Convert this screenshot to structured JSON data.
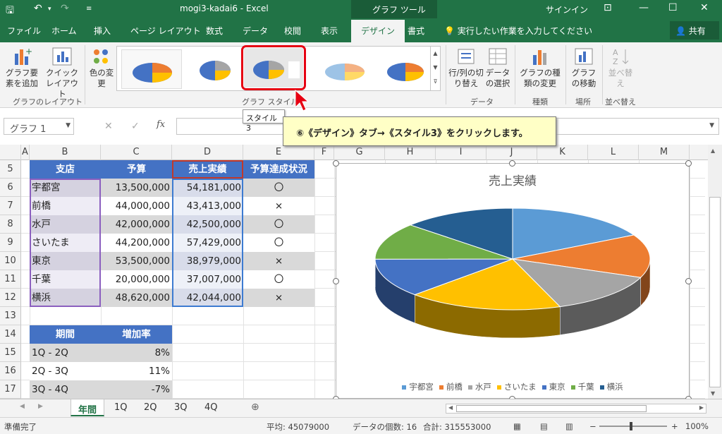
{
  "window": {
    "title": "mogi3-kadai6 - Excel",
    "tools_label": "グラフ ツール",
    "signin": "サインイン"
  },
  "tabs": [
    "ファイル",
    "ホーム",
    "挿入",
    "ページ レイアウト",
    "数式",
    "データ",
    "校閲",
    "表示",
    "デザイン",
    "書式"
  ],
  "tellme": "実行したい作業を入力してください",
  "share": "共有",
  "ribbon": {
    "add_element": "グラフ要素を追加",
    "quick_layout": "クイックレイアウト",
    "layout_group": "グラフのレイアウト",
    "colors": "色の変更",
    "style_group": "グラフ スタイル",
    "switch": "行/列の切り替え",
    "select_data": "データの選択",
    "data_group": "データ",
    "change_type": "グラフの種類の変更",
    "type_group": "種類",
    "move": "グラフの移動",
    "place_group": "場所",
    "sort": "並べ替え",
    "sort_group": "並べ替え"
  },
  "tooltip": "スタイル 3",
  "callout": "⑥《デザイン》タブ→《スタイル3》をクリックします。",
  "namebox": "グラフ 1",
  "columns": [
    "A",
    "B",
    "C",
    "D",
    "E",
    "F",
    "G",
    "H",
    "I",
    "J",
    "K",
    "L",
    "M"
  ],
  "rows": [
    "5",
    "6",
    "7",
    "8",
    "9",
    "10",
    "11",
    "12",
    "13",
    "14",
    "15",
    "16",
    "17"
  ],
  "table1": {
    "headers": [
      "支店",
      "予算",
      "売上実績",
      "予算達成状況"
    ],
    "rows": [
      [
        "宇都宮",
        "13,500,000",
        "54,181,000",
        "〇"
      ],
      [
        "前橋",
        "44,000,000",
        "43,413,000",
        "×"
      ],
      [
        "水戸",
        "42,000,000",
        "42,500,000",
        "〇"
      ],
      [
        "さいたま",
        "44,200,000",
        "57,429,000",
        "〇"
      ],
      [
        "東京",
        "53,500,000",
        "38,979,000",
        "×"
      ],
      [
        "千葉",
        "20,000,000",
        "37,007,000",
        "〇"
      ],
      [
        "横浜",
        "48,620,000",
        "42,044,000",
        "×"
      ]
    ]
  },
  "table2": {
    "headers": [
      "期間",
      "増加率"
    ],
    "rows": [
      [
        "1Q - 2Q",
        "8%"
      ],
      [
        "2Q - 3Q",
        "11%"
      ],
      [
        "3Q - 4Q",
        "-7%"
      ]
    ]
  },
  "chart_data": {
    "type": "pie",
    "title": "売上実績",
    "categories": [
      "宇都宮",
      "前橋",
      "水戸",
      "さいたま",
      "東京",
      "千葉",
      "横浜"
    ],
    "values": [
      54181000,
      43413000,
      42500000,
      57429000,
      38979000,
      37007000,
      42044000
    ],
    "colors": [
      "#5b9bd5",
      "#ed7d31",
      "#a5a5a5",
      "#ffc000",
      "#4472c4",
      "#70ad47",
      "#255e91"
    ],
    "legend": "bottom"
  },
  "sheets": [
    "年間",
    "1Q",
    "2Q",
    "3Q",
    "4Q"
  ],
  "status": {
    "ready": "準備完了",
    "average": "平均: 45079000",
    "count": "データの個数: 16",
    "sum": "合計: 315553000",
    "zoom": "100%"
  }
}
